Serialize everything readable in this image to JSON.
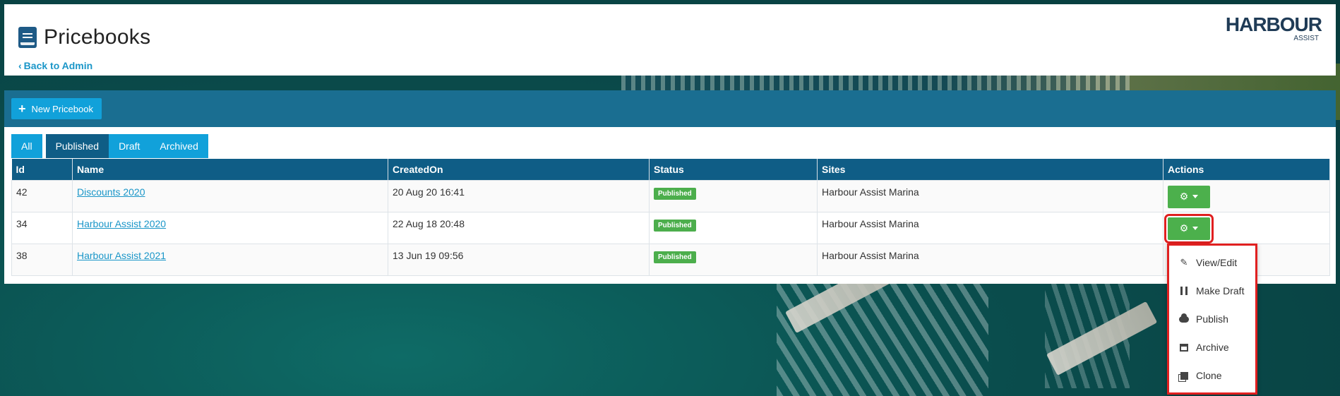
{
  "header": {
    "title": "Pricebooks",
    "back_link": "Back to Admin",
    "logo_main": "HARBOUR",
    "logo_sub": "ASSIST"
  },
  "toolbar": {
    "new_button": "New Pricebook"
  },
  "tabs": [
    {
      "label": "All",
      "active": false
    },
    {
      "label": "Published",
      "active": true
    },
    {
      "label": "Draft",
      "active": false
    },
    {
      "label": "Archived",
      "active": false
    }
  ],
  "table": {
    "columns": [
      "Id",
      "Name",
      "CreatedOn",
      "Status",
      "Sites",
      "Actions"
    ],
    "rows": [
      {
        "id": "42",
        "name": "Discounts 2020",
        "created": "20 Aug 20 16:41",
        "status": "Published",
        "site": "Harbour Assist Marina"
      },
      {
        "id": "34",
        "name": "Harbour Assist 2020",
        "created": "22 Aug 18 20:48",
        "status": "Published",
        "site": "Harbour Assist Marina"
      },
      {
        "id": "38",
        "name": "Harbour Assist 2021",
        "created": "13 Jun 19 09:56",
        "status": "Published",
        "site": "Harbour Assist Marina"
      }
    ]
  },
  "actions_menu": {
    "items": [
      {
        "label": "View/Edit",
        "icon": "pencil-icon"
      },
      {
        "label": "Make Draft",
        "icon": "pause-icon"
      },
      {
        "label": "Publish",
        "icon": "cloud-icon"
      },
      {
        "label": "Archive",
        "icon": "archive-icon"
      },
      {
        "label": "Clone",
        "icon": "clone-icon"
      }
    ]
  },
  "colors": {
    "toolbar": "#1a6e91",
    "table_header": "#0f5d86",
    "accent": "#11a1da",
    "success": "#4cae4c",
    "highlight": "#e02020"
  }
}
